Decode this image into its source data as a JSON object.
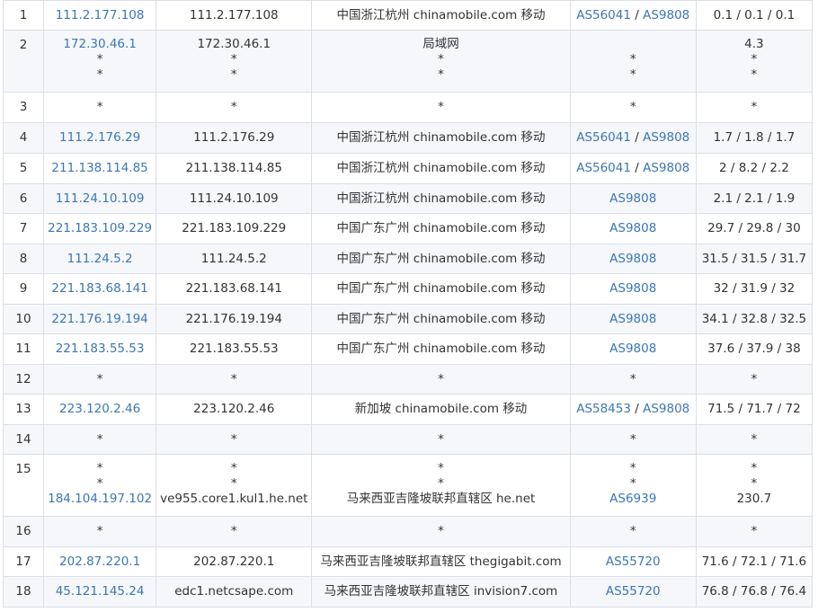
{
  "hops": [
    {
      "hop": "1",
      "ip": [
        "111.2.177.108"
      ],
      "host": [
        "111.2.177.108"
      ],
      "location": [
        "中国浙江杭州 chinamobile.com 移动"
      ],
      "asn": [
        [
          "AS56041",
          "AS9808"
        ]
      ],
      "time": [
        "0.1 / 0.1 / 0.1"
      ]
    },
    {
      "hop": "2",
      "ip": [
        "172.30.46.1",
        "*",
        "*"
      ],
      "host": [
        "172.30.46.1",
        "*",
        "*"
      ],
      "location": [
        "局域网",
        "*",
        "*"
      ],
      "asn": [
        [],
        [
          "*"
        ],
        [
          "*"
        ]
      ],
      "time": [
        "4.3",
        "*",
        "*"
      ]
    },
    {
      "hop": "3",
      "ip": [
        "*"
      ],
      "host": [
        "*"
      ],
      "location": [
        "*"
      ],
      "asn": [
        [
          "*"
        ]
      ],
      "time": [
        "*"
      ]
    },
    {
      "hop": "4",
      "ip": [
        "111.2.176.29"
      ],
      "host": [
        "111.2.176.29"
      ],
      "location": [
        "中国浙江杭州 chinamobile.com 移动"
      ],
      "asn": [
        [
          "AS56041",
          "AS9808"
        ]
      ],
      "time": [
        "1.7 / 1.8 / 1.7"
      ]
    },
    {
      "hop": "5",
      "ip": [
        "211.138.114.85"
      ],
      "host": [
        "211.138.114.85"
      ],
      "location": [
        "中国浙江杭州 chinamobile.com 移动"
      ],
      "asn": [
        [
          "AS56041",
          "AS9808"
        ]
      ],
      "time": [
        "2 / 8.2 / 2.2"
      ]
    },
    {
      "hop": "6",
      "ip": [
        "111.24.10.109"
      ],
      "host": [
        "111.24.10.109"
      ],
      "location": [
        "中国浙江杭州 chinamobile.com 移动"
      ],
      "asn": [
        [
          "AS9808"
        ]
      ],
      "time": [
        "2.1 / 2.1 / 1.9"
      ]
    },
    {
      "hop": "7",
      "ip": [
        "221.183.109.229"
      ],
      "host": [
        "221.183.109.229"
      ],
      "location": [
        "中国广东广州 chinamobile.com 移动"
      ],
      "asn": [
        [
          "AS9808"
        ]
      ],
      "time": [
        "29.7 / 29.8 / 30"
      ]
    },
    {
      "hop": "8",
      "ip": [
        "111.24.5.2"
      ],
      "host": [
        "111.24.5.2"
      ],
      "location": [
        "中国广东广州 chinamobile.com 移动"
      ],
      "asn": [
        [
          "AS9808"
        ]
      ],
      "time": [
        "31.5 / 31.5 / 31.7"
      ]
    },
    {
      "hop": "9",
      "ip": [
        "221.183.68.141"
      ],
      "host": [
        "221.183.68.141"
      ],
      "location": [
        "中国广东广州 chinamobile.com 移动"
      ],
      "asn": [
        [
          "AS9808"
        ]
      ],
      "time": [
        "32 / 31.9 / 32"
      ]
    },
    {
      "hop": "10",
      "ip": [
        "221.176.19.194"
      ],
      "host": [
        "221.176.19.194"
      ],
      "location": [
        "中国广东广州 chinamobile.com 移动"
      ],
      "asn": [
        [
          "AS9808"
        ]
      ],
      "time": [
        "34.1 / 32.8 / 32.5"
      ]
    },
    {
      "hop": "11",
      "ip": [
        "221.183.55.53"
      ],
      "host": [
        "221.183.55.53"
      ],
      "location": [
        "中国广东广州 chinamobile.com 移动"
      ],
      "asn": [
        [
          "AS9808"
        ]
      ],
      "time": [
        "37.6 / 37.9 / 38"
      ]
    },
    {
      "hop": "12",
      "ip": [
        "*"
      ],
      "host": [
        "*"
      ],
      "location": [
        "*"
      ],
      "asn": [
        [
          "*"
        ]
      ],
      "time": [
        "*"
      ]
    },
    {
      "hop": "13",
      "ip": [
        "223.120.2.46"
      ],
      "host": [
        "223.120.2.46"
      ],
      "location": [
        "新加坡 chinamobile.com 移动"
      ],
      "asn": [
        [
          "AS58453",
          "AS9808"
        ]
      ],
      "time": [
        "71.5 / 71.7 / 72"
      ]
    },
    {
      "hop": "14",
      "ip": [
        "*"
      ],
      "host": [
        "*"
      ],
      "location": [
        "*"
      ],
      "asn": [
        [
          "*"
        ]
      ],
      "time": [
        "*"
      ]
    },
    {
      "hop": "15",
      "ip": [
        "*",
        "*",
        "184.104.197.102"
      ],
      "host": [
        "*",
        "*",
        "ve955.core1.kul1.he.net"
      ],
      "location": [
        "*",
        "*",
        "马来西亚吉隆坡联邦直辖区 he.net"
      ],
      "asn": [
        [
          "*"
        ],
        [
          "*"
        ],
        [
          "AS6939"
        ]
      ],
      "time": [
        "*",
        "*",
        "230.7"
      ]
    },
    {
      "hop": "16",
      "ip": [
        "*"
      ],
      "host": [
        "*"
      ],
      "location": [
        "*"
      ],
      "asn": [
        [
          "*"
        ]
      ],
      "time": [
        "*"
      ]
    },
    {
      "hop": "17",
      "ip": [
        "202.87.220.1"
      ],
      "host": [
        "202.87.220.1"
      ],
      "location": [
        "马来西亚吉隆坡联邦直辖区 thegigabit.com"
      ],
      "asn": [
        [
          "AS55720"
        ]
      ],
      "time": [
        "71.6 / 72.1 / 71.6"
      ]
    },
    {
      "hop": "18",
      "ip": [
        "45.121.145.24"
      ],
      "host": [
        "edc1.netcsape.com"
      ],
      "location": [
        "马来西亚吉隆坡联邦直辖区 invision7.com"
      ],
      "asn": [
        [
          "AS55720"
        ]
      ],
      "time": [
        "76.8 / 76.8 / 76.4"
      ]
    }
  ]
}
